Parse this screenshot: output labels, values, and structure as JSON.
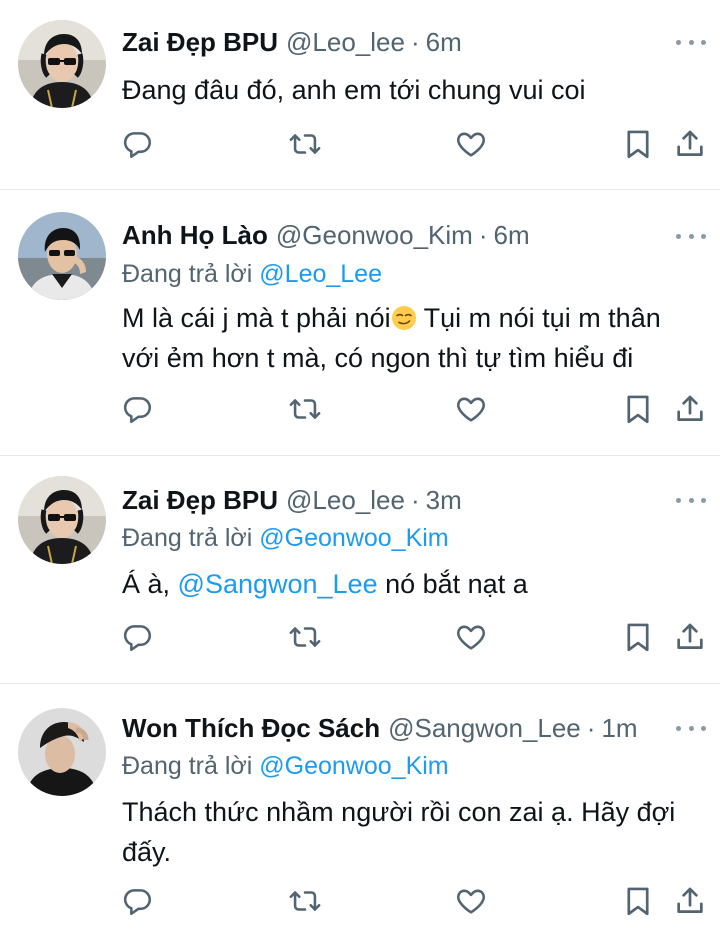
{
  "tweets": [
    {
      "name": "Zai Đẹp BPU",
      "handle": "@Leo_lee",
      "sep": "·",
      "time": "6m",
      "reply_prefix": "",
      "reply_to": "",
      "text_parts": [
        "Đang đâu đó, anh em tới chung vui coi"
      ],
      "avatar": "avatar-sunglasses-man"
    },
    {
      "name": "Anh Họ Lào",
      "handle": "@Geonwoo_Kim",
      "sep": "·",
      "time": "6m",
      "reply_prefix": "Đang trả lời ",
      "reply_to": "@Leo_Lee",
      "text_parts": [
        "M là cái j mà t phải nói",
        " Tụi m nói tụi m thân với ẻm hơn t mà, có ngon thì tự tìm hiểu đi"
      ],
      "emoji": "smirking-face-emoji",
      "avatar": "avatar-man-adjusting-glasses"
    },
    {
      "name": "Zai Đẹp BPU",
      "handle": "@Leo_lee",
      "sep": "·",
      "time": "3m",
      "reply_prefix": "Đang trả lời ",
      "reply_to": "@Geonwoo_Kim",
      "text_parts": [
        "Á à, ",
        "@Sangwon_Lee",
        " nó bắt nạt a"
      ],
      "avatar": "avatar-sunglasses-man"
    },
    {
      "name": "Won Thích Đọc Sách",
      "handle": "@Sangwon_Lee",
      "sep": "·",
      "time": "1m",
      "reply_prefix": "Đang trả lời ",
      "reply_to": "@Geonwoo_Kim",
      "text_parts": [
        "Thách thức nhầm người rồi con zai ạ. Hãy đợi đấy."
      ],
      "avatar": "avatar-man-hand-on-head"
    }
  ],
  "icons": [
    "reply-icon",
    "retweet-icon",
    "like-icon",
    "bookmark-icon",
    "share-icon",
    "more-icon"
  ],
  "colors": {
    "text": "#0f1419",
    "secondary": "#536471",
    "link": "#1d9bf0",
    "divider": "#e6e9eb"
  }
}
